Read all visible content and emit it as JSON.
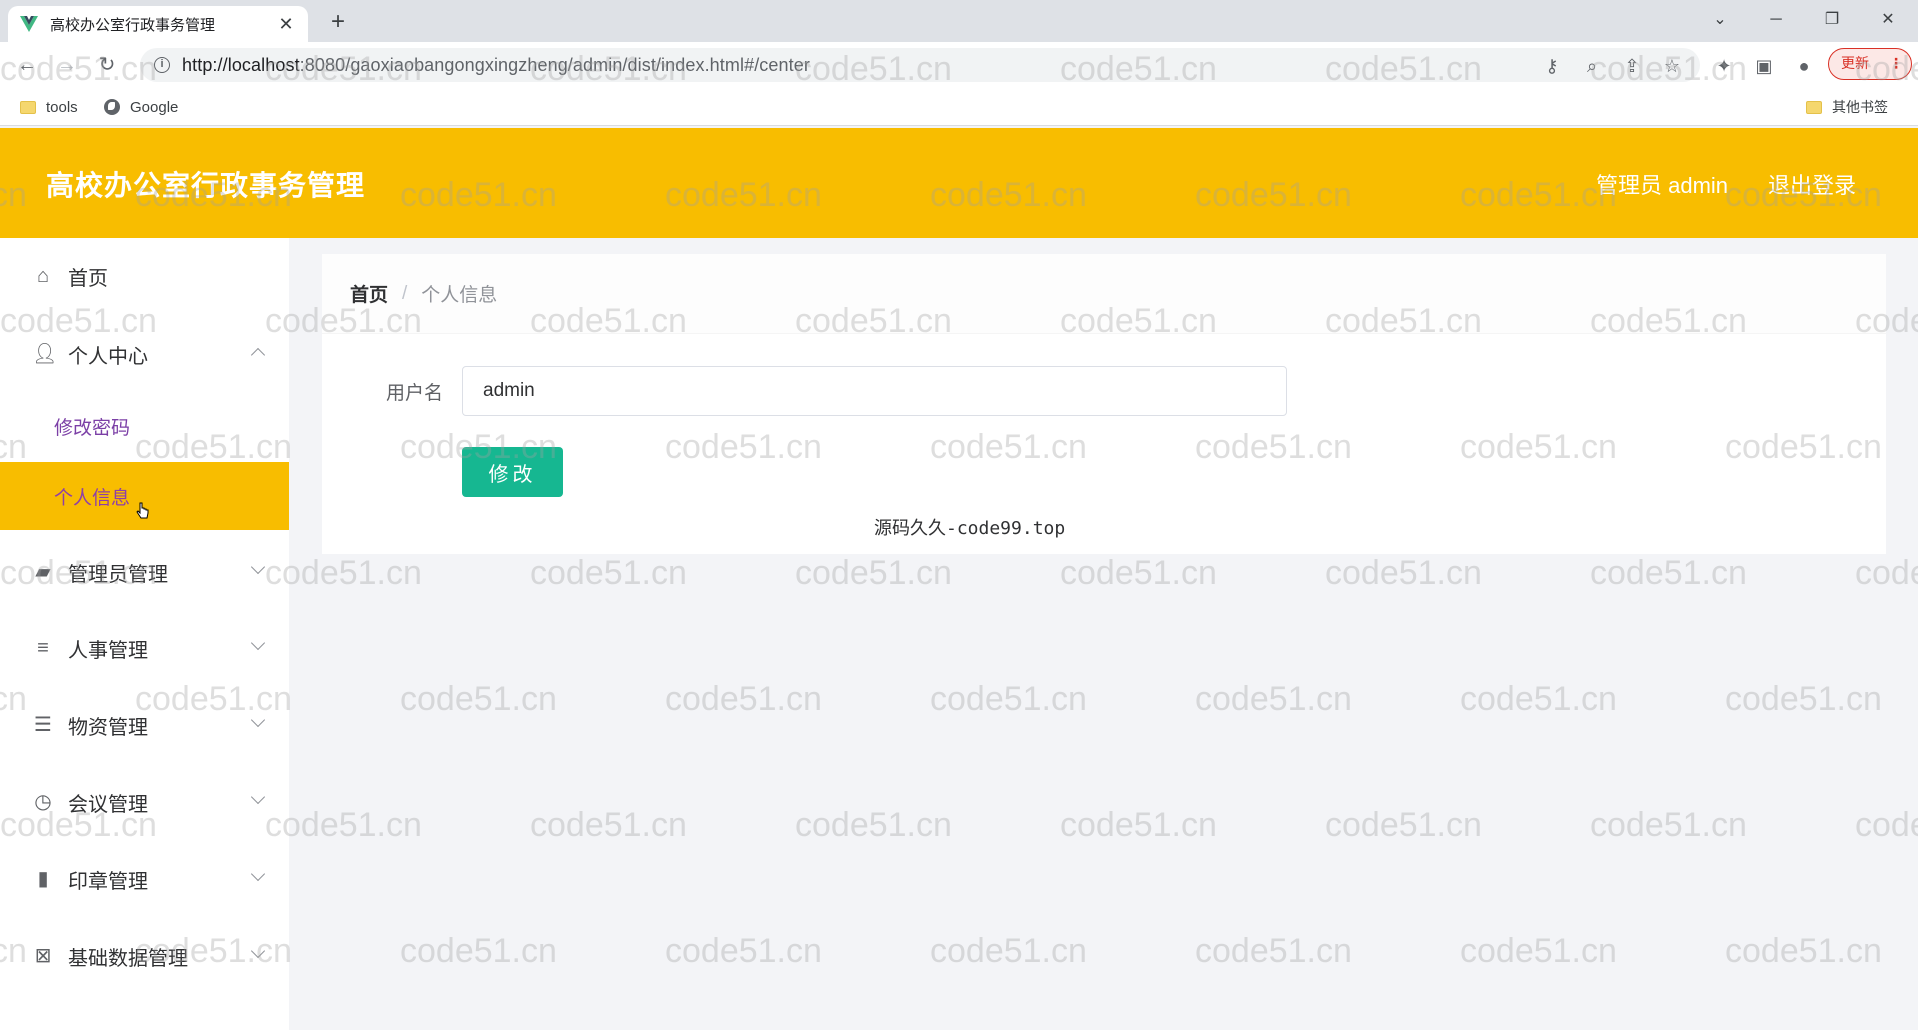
{
  "browser": {
    "tab_title": "高校办公室行政事务管理",
    "new_tab_symbol": "+",
    "url_host": "http://localhost",
    "url_rest": ":8080/gaoxiaobangongxingzheng/admin/dist/index.html#/center",
    "update_label": "更新",
    "bookmarks": [
      {
        "label": "tools",
        "icon": "folder-icon"
      },
      {
        "label": "Google",
        "icon": "globe-icon"
      }
    ],
    "other_bookmarks": "其他书签"
  },
  "header": {
    "title": "高校办公室行政事务管理",
    "user": "管理员 admin",
    "logout": "退出登录",
    "background": "#f8bd00"
  },
  "sidebar": {
    "home": "首页",
    "personal_center": "个人中心",
    "change_password": "修改密码",
    "personal_info": "个人信息",
    "admin_mgmt": "管理员管理",
    "hr_mgmt": "人事管理",
    "material_mgmt": "物资管理",
    "meeting_mgmt": "会议管理",
    "seal_mgmt": "印章管理",
    "base_data_mgmt": "基础数据管理"
  },
  "breadcrumb": {
    "home": "首页",
    "separator": "/",
    "current": "个人信息"
  },
  "form": {
    "username_label": "用户名",
    "username_value": "admin",
    "submit_label": "修改"
  },
  "footer": "源码久久-code99.top",
  "watermark": "code51.cn",
  "accent_color": "#16b791"
}
